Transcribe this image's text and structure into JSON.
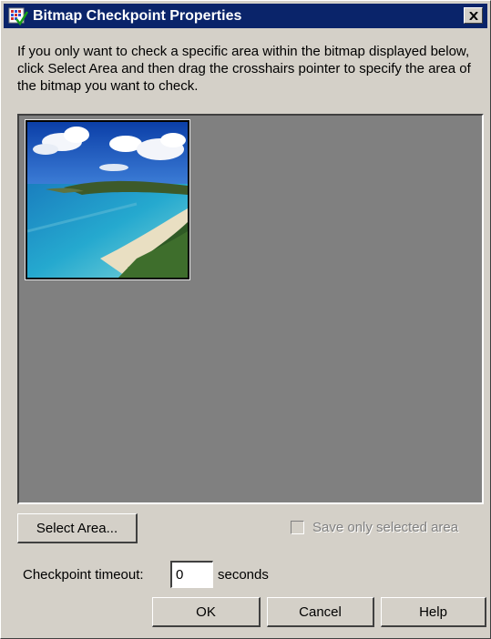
{
  "window": {
    "title": "Bitmap Checkpoint Properties",
    "title_color": "#0a246a",
    "app_icon": "checkpoint-grid-icon",
    "close_icon": "close-icon"
  },
  "instructions": "If you only want to check a specific area within the bitmap displayed below, click Select Area and then drag the crosshairs pointer to specify the area of the bitmap you want to check.",
  "preview": {
    "background": "#808080",
    "image_subject": "beach-bay-photo"
  },
  "select_area_label": "Select Area...",
  "save_only_selected": {
    "label": "Save only selected area",
    "checked": false,
    "enabled": false
  },
  "timeout": {
    "label": "Checkpoint timeout:",
    "value": "0",
    "unit": "seconds"
  },
  "buttons": {
    "ok": "OK",
    "cancel": "Cancel",
    "help": "Help"
  }
}
